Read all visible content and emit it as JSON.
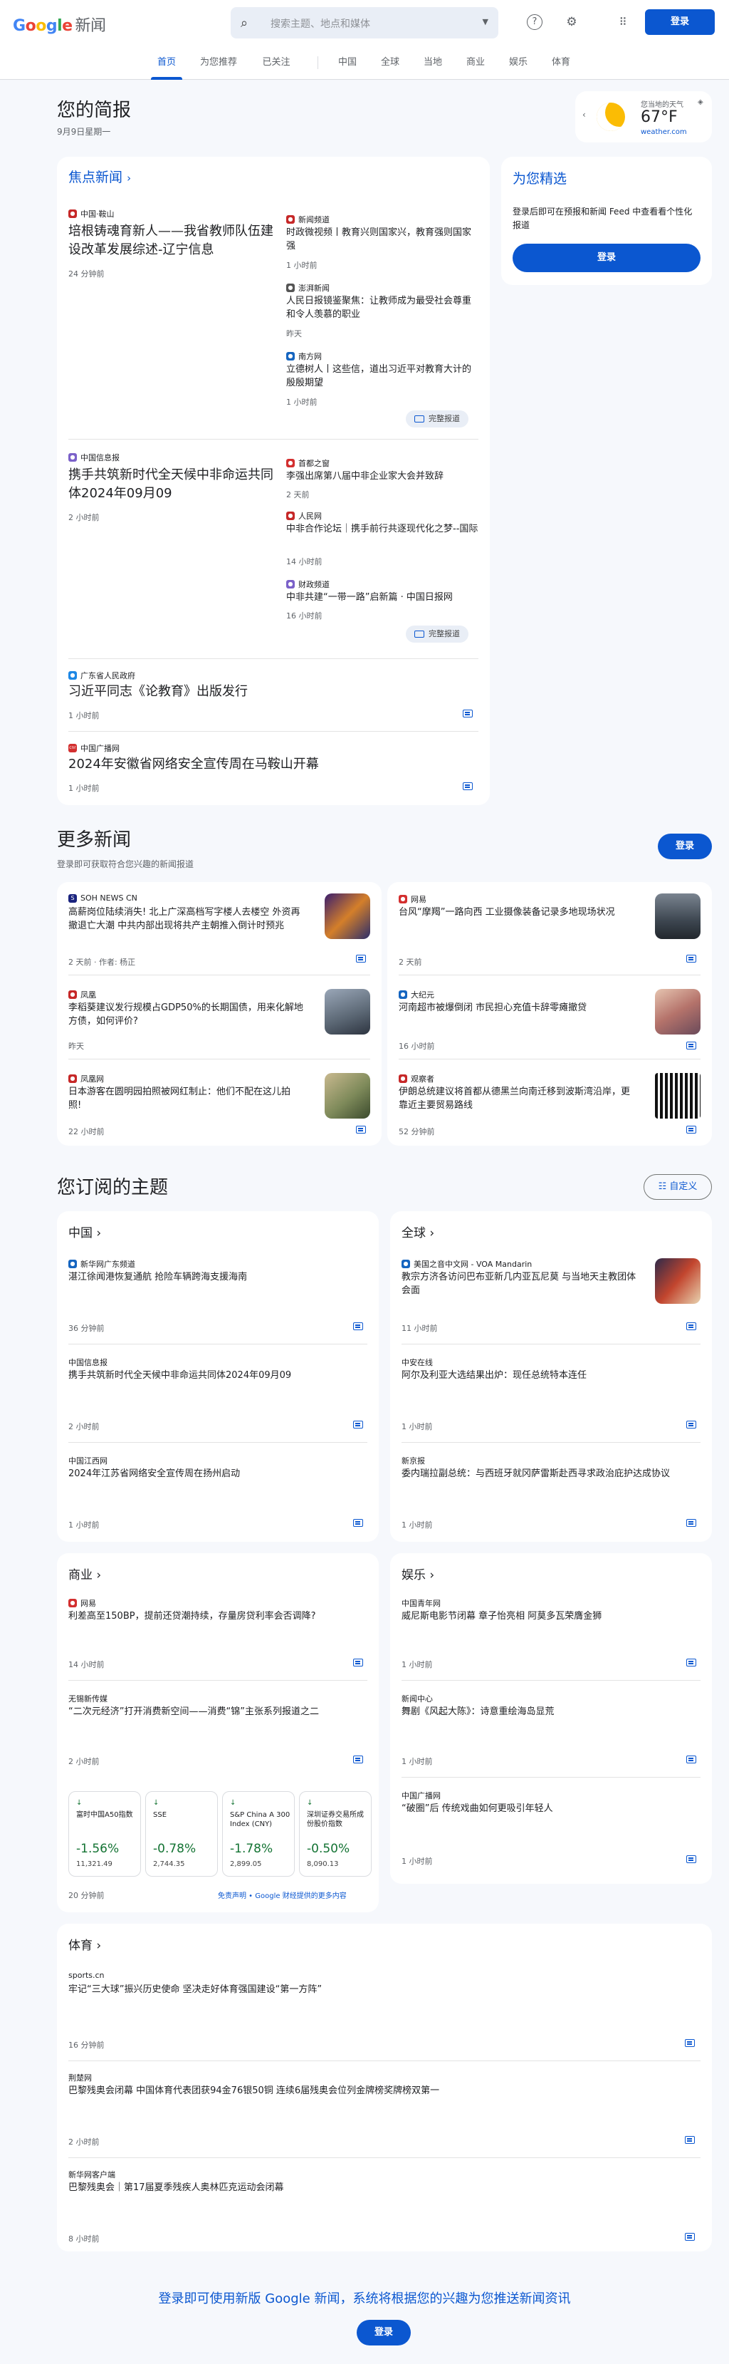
{
  "header": {
    "logo_google": "Google",
    "logo_news": "新闻",
    "search_placeholder": "搜索主题、地点和媒体",
    "login": "登录"
  },
  "nav": {
    "tabs": [
      "首页",
      "为您推荐",
      "已关注",
      "中国",
      "全球",
      "当地",
      "商业",
      "娱乐",
      "体育"
    ]
  },
  "briefing": {
    "title": "您的简报",
    "date": "9月9日星期一"
  },
  "weather": {
    "label": "您当地的天气",
    "temp": "67°F",
    "source": "weather.com"
  },
  "picks": {
    "title": "为您精选",
    "desc": "登录后即可在预报和新闻 Feed 中查看看个性化报道",
    "button": "登录"
  },
  "top_stories": {
    "title": "焦点新闻",
    "full_coverage": "完整报道",
    "clusters": [
      {
        "main": {
          "source": "中国·鞍山",
          "title": "培根铸魂育新人——我省教师队伍建设改革发展综述-辽宁信息",
          "time": "24 分钟前"
        },
        "side": [
          {
            "source": "新闻频道",
            "title": "时政微视频丨教育兴则国家兴，教育强则国家强",
            "time": "1 小时前"
          },
          {
            "source": "澎湃新闻",
            "title": "人民日报镜鉴聚焦：让教师成为最受社会尊重和令人羡慕的职业",
            "time": "昨天"
          },
          {
            "source": "南方网",
            "title": "立德树人丨这些信，道出习近平对教育大计的殷殷期望",
            "time": "1 小时前"
          }
        ]
      },
      {
        "main": {
          "source": "中国信息报",
          "title": "携手共筑新时代全天候中非命运共同体2024年09月09",
          "time": "2 小时前"
        },
        "side": [
          {
            "source": "首都之窗",
            "title": "李强出席第八届中非企业家大会并致辞",
            "time": "2 天前"
          },
          {
            "source": "人民网",
            "title": "中非合作论坛｜携手前行共逐现代化之梦--国际",
            "time": "14 小时前"
          },
          {
            "source": "财政频道",
            "title": "中非共建“一带一路”启新篇 · 中国日报网",
            "time": "16 小时前"
          }
        ]
      }
    ],
    "singles": [
      {
        "source": "广东省人民政府",
        "title": "习近平同志《论教育》出版发行",
        "time": "1 小时前"
      },
      {
        "source": "中国广播网",
        "title": "2024年安徽省网络安全宣传周在马鞍山开幕",
        "time": "1 小时前"
      }
    ]
  },
  "more_news": {
    "title": "更多新闻",
    "desc": "登录即可获取符合您兴趣的新闻报道",
    "login": "登录",
    "items": [
      {
        "source": "SOH NEWS CN",
        "title": "高薪岗位陆续消失! 北上广深高档写字楼人去楼空 外资再撤退亡大潮 中共内部出现将共产主朝推入倒计时预兆",
        "time": "2 天前 · 作者: 杨正"
      },
      {
        "source": "网易",
        "title": "台风“摩羯”一路向西 工业摄像装备记录多地现场状况",
        "time": "2 天前"
      },
      {
        "source": "凤凰",
        "title": "李稻葵建议发行规模占GDP50%的长期国债，用来化解地方债，如何评价?",
        "time": "昨天"
      },
      {
        "source": "大纪元",
        "title": "河南超市被爆倒闭 市民担心充值卡辞零瘫撤贷",
        "time": "16 小时前"
      },
      {
        "source": "凤凰网",
        "title": "日本游客在圆明园拍照被网红制止：他们不配在这儿拍照!",
        "time": "22 小时前"
      },
      {
        "source": "观察者",
        "title": "伊朗总统建议将首都从德黑兰向南迁移到波斯湾沿岸，更靠近主要贸易路线",
        "time": "52 分钟前"
      }
    ]
  },
  "subscribed": {
    "title": "您订阅的主题",
    "customize": "自定义",
    "china": {
      "title": "中国",
      "items": [
        {
          "source": "新华网广东频道",
          "title": "湛江徐闻港恢复通航 抢险车辆跨海支援海南",
          "time": "36 分钟前"
        },
        {
          "source": "中国信息报",
          "title": "携手共筑新时代全天候中非命运共同体2024年09月09",
          "time": "2 小时前"
        },
        {
          "source": "中国江西网",
          "title": "2024年江苏省网络安全宣传周在扬州启动",
          "time": "1 小时前"
        }
      ]
    },
    "world": {
      "title": "全球",
      "items": [
        {
          "source": "美国之音中文网 - VOA Mandarin",
          "title": "教宗方济各访问巴布亚新几内亚瓦尼莫 与当地天主教团体会面",
          "time": "11 小时前"
        },
        {
          "source": "中安在线",
          "title": "阿尔及利亚大选结果出炉：现任总统特本连任",
          "time": "1 小时前"
        },
        {
          "source": "新京报",
          "title": "委内瑞拉副总统：与西班牙就冈萨雷斯赴西寻求政治庇护达成协议",
          "time": "1 小时前"
        }
      ]
    },
    "business": {
      "title": "商业",
      "items": [
        {
          "source": "网易",
          "title": "利差高至150BP，提前还贷潮持续，存量房贷利率会否调降?",
          "time": "14 小时前"
        },
        {
          "source": "无锡新传媒",
          "title": "“二次元经济”打开消费新空间——消费“锦”主张系列报道之二",
          "time": "2 小时前"
        }
      ],
      "stocks": [
        {
          "name": "富时中国A50指数",
          "pct": "-1.56%",
          "val": "11,321.49"
        },
        {
          "name": "SSE",
          "pct": "-0.78%",
          "val": "2,744.35"
        },
        {
          "name": "S&P China A 300 Index (CNY)",
          "pct": "-1.78%",
          "val": "2,899.05"
        },
        {
          "name": "深圳证券交易所成份股价指数",
          "pct": "-0.50%",
          "val": "8,090.13"
        }
      ],
      "stock_time": "20 分钟前",
      "disclaimer": "免责声明 • Google 财经提供的更多内容"
    },
    "ent": {
      "title": "娱乐",
      "items": [
        {
          "source": "中国青年网",
          "title": "威尼斯电影节闭幕 章子怡亮相 阿莫多瓦荣膺金狮",
          "time": "1 小时前"
        },
        {
          "source": "新闻中心",
          "title": "舞剧《风起大陈》：诗意重绘海岛显荒",
          "time": "1 小时前"
        },
        {
          "source": "中国广播网",
          "title": "“破圈”后 传统戏曲如何更吸引年轻人",
          "time": "1 小时前"
        }
      ]
    },
    "sports": {
      "title": "体育",
      "items": [
        {
          "source": "sports.cn",
          "title": "牢记“三大球”振兴历史使命 坚决走好体育强国建设“第一方阵”",
          "time": "16 分钟前"
        },
        {
          "source": "荆楚网",
          "title": "巴黎残奥会闭幕 中国体育代表团获94金76银50铜 连续6届残奥会位列金牌榜奖牌榜双第一",
          "time": "2 小时前"
        },
        {
          "source": "新华网客户端",
          "title": "巴黎残奥会｜第17届夏季残疾人奥林匹克运动会闭幕",
          "time": "8 小时前"
        }
      ]
    }
  },
  "footer": {
    "cta": "登录即可使用新版 Google 新闻，系统将根据您的兴趣为您推送新闻资讯",
    "login": "登录"
  },
  "colors": {
    "accent": "#0b57d0",
    "down": "#137333"
  }
}
